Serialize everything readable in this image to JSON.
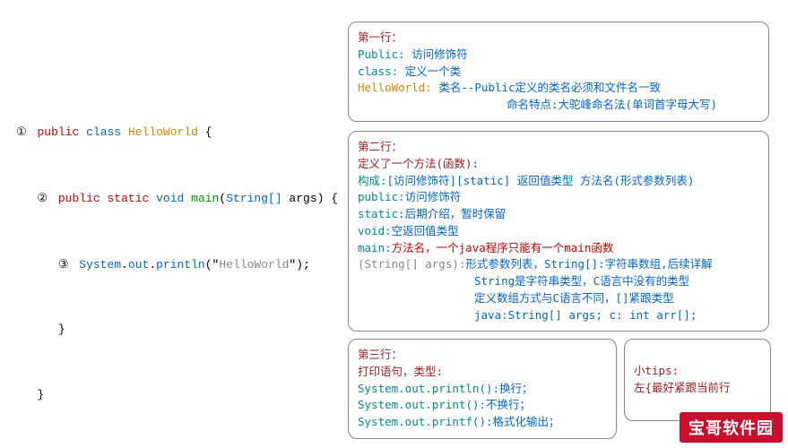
{
  "code": {
    "n1": "①",
    "n2": "②",
    "n3": "③",
    "l1_public": "public",
    "l1_class": "class",
    "l1_name": "HelloWorld",
    "l1_brace": " {",
    "l2_public": "public",
    "l2_static": "static",
    "l2_void": "void",
    "l2_main": "main",
    "l2_paren_open": "(",
    "l2_type": "String[]",
    "l2_arg": " args",
    "l2_paren_close": ")",
    "l2_brace": " {",
    "l3_system": "System",
    "l3_dot1": ".",
    "l3_out": "out",
    "l3_dot2": ".",
    "l3_println": "println",
    "l3_open": "(",
    "l3_q1": "\"",
    "l3_str": "HelloWorld",
    "l3_q2": "\"",
    "l3_close": ")",
    "l3_semi": ";",
    "l4_brace": "}",
    "l5_brace": "}"
  },
  "box1": {
    "title": "第一行：",
    "r1_k": "Public:",
    "r1_v": " 访问修饰符",
    "r2_k": "class:",
    "r2_v": " 定义一个类",
    "r3_k": "HelloWorld:",
    "r3_v": " 类名--Public定义的类名必须和文件名一致",
    "r4": "命名特点:大驼峰命名法(单词首字母大写)"
  },
  "box2": {
    "title": "第二行：",
    "sub": "定义了一个方法(函数):",
    "r1_k": "构成:",
    "r1_v": "[访问修饰符][static] 返回值类型 方法名(形式参数列表)",
    "r2_k": "public:",
    "r2_v": "访问修饰符",
    "r3_k": "static:",
    "r3_v": "后期介绍，暂时保留",
    "r4_k": "void:",
    "r4_v": "空返回值类型",
    "r5_k": "main:",
    "r5_v": "方法名，一个java程序只能有一个main函数",
    "r6_k": "(String[] args):",
    "r6_v": "形式参数列表，String[]:字符串数组,后续详解",
    "r7": "String是字符串类型，C语言中没有的类型",
    "r8": "定义数组方式与C语言不同，[]紧跟类型",
    "r9": "java:String[] args; c: int arr[];"
  },
  "box3": {
    "title": "第三行：",
    "sub": "打印语句，类型:",
    "r1_k": "System.out.println():",
    "r1_v": "换行；",
    "r2_k": "System.out.print():",
    "r2_v": "不换行；",
    "r3_k": "System.out.printf():",
    "r3_v": "格式化输出；"
  },
  "box4": {
    "title": "小tips:",
    "line": "左{最好紧跟当前行"
  },
  "badge": "宝哥软件园"
}
